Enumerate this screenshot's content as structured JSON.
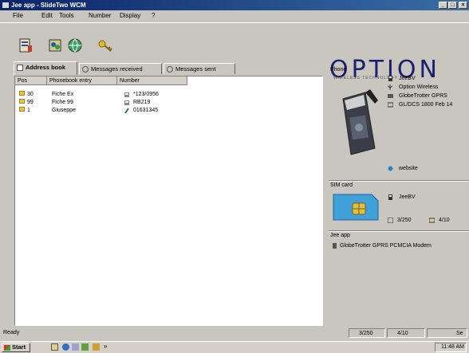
{
  "window": {
    "title": "Jee app - SlideTwo WCM"
  },
  "menu": [
    "File",
    "Edit",
    "Tools",
    "Number",
    "Display",
    "?"
  ],
  "logo": {
    "text": "OPTION",
    "tagline": "WIRELESS TECHNOLOGY"
  },
  "tabs": [
    "Address book",
    "Messages received",
    "Messages sent"
  ],
  "table": {
    "headers": [
      "Pos",
      "Phonebook entry",
      "Number"
    ],
    "rows": [
      {
        "pos": "30",
        "name": "Fiche Ex",
        "number": "*123/0956"
      },
      {
        "pos": "99",
        "name": "Fiche 99",
        "number": "RB219"
      },
      {
        "pos": "1",
        "name": "Giuseppe",
        "number": "01631345"
      }
    ]
  },
  "phone": {
    "group": "Phone",
    "info": [
      "JeeBV",
      "Option Wireless",
      "GlobeTrotter GPRS",
      "GL/DCS 1800 Feb 14"
    ],
    "website": "website"
  },
  "sim": {
    "group": "SIM card",
    "operator": "JeeBV",
    "contacts": "3/250",
    "messages": "4/10"
  },
  "jee": {
    "group": "Jee app",
    "device": "GlobeTrotter GPRS PCMCIA Modem"
  },
  "status": {
    "text": "Ready",
    "contacts": "3/250",
    "messages": "4/10",
    "extra": "Se"
  },
  "taskbar": {
    "start": "Start",
    "clock": "11:48 AM"
  }
}
